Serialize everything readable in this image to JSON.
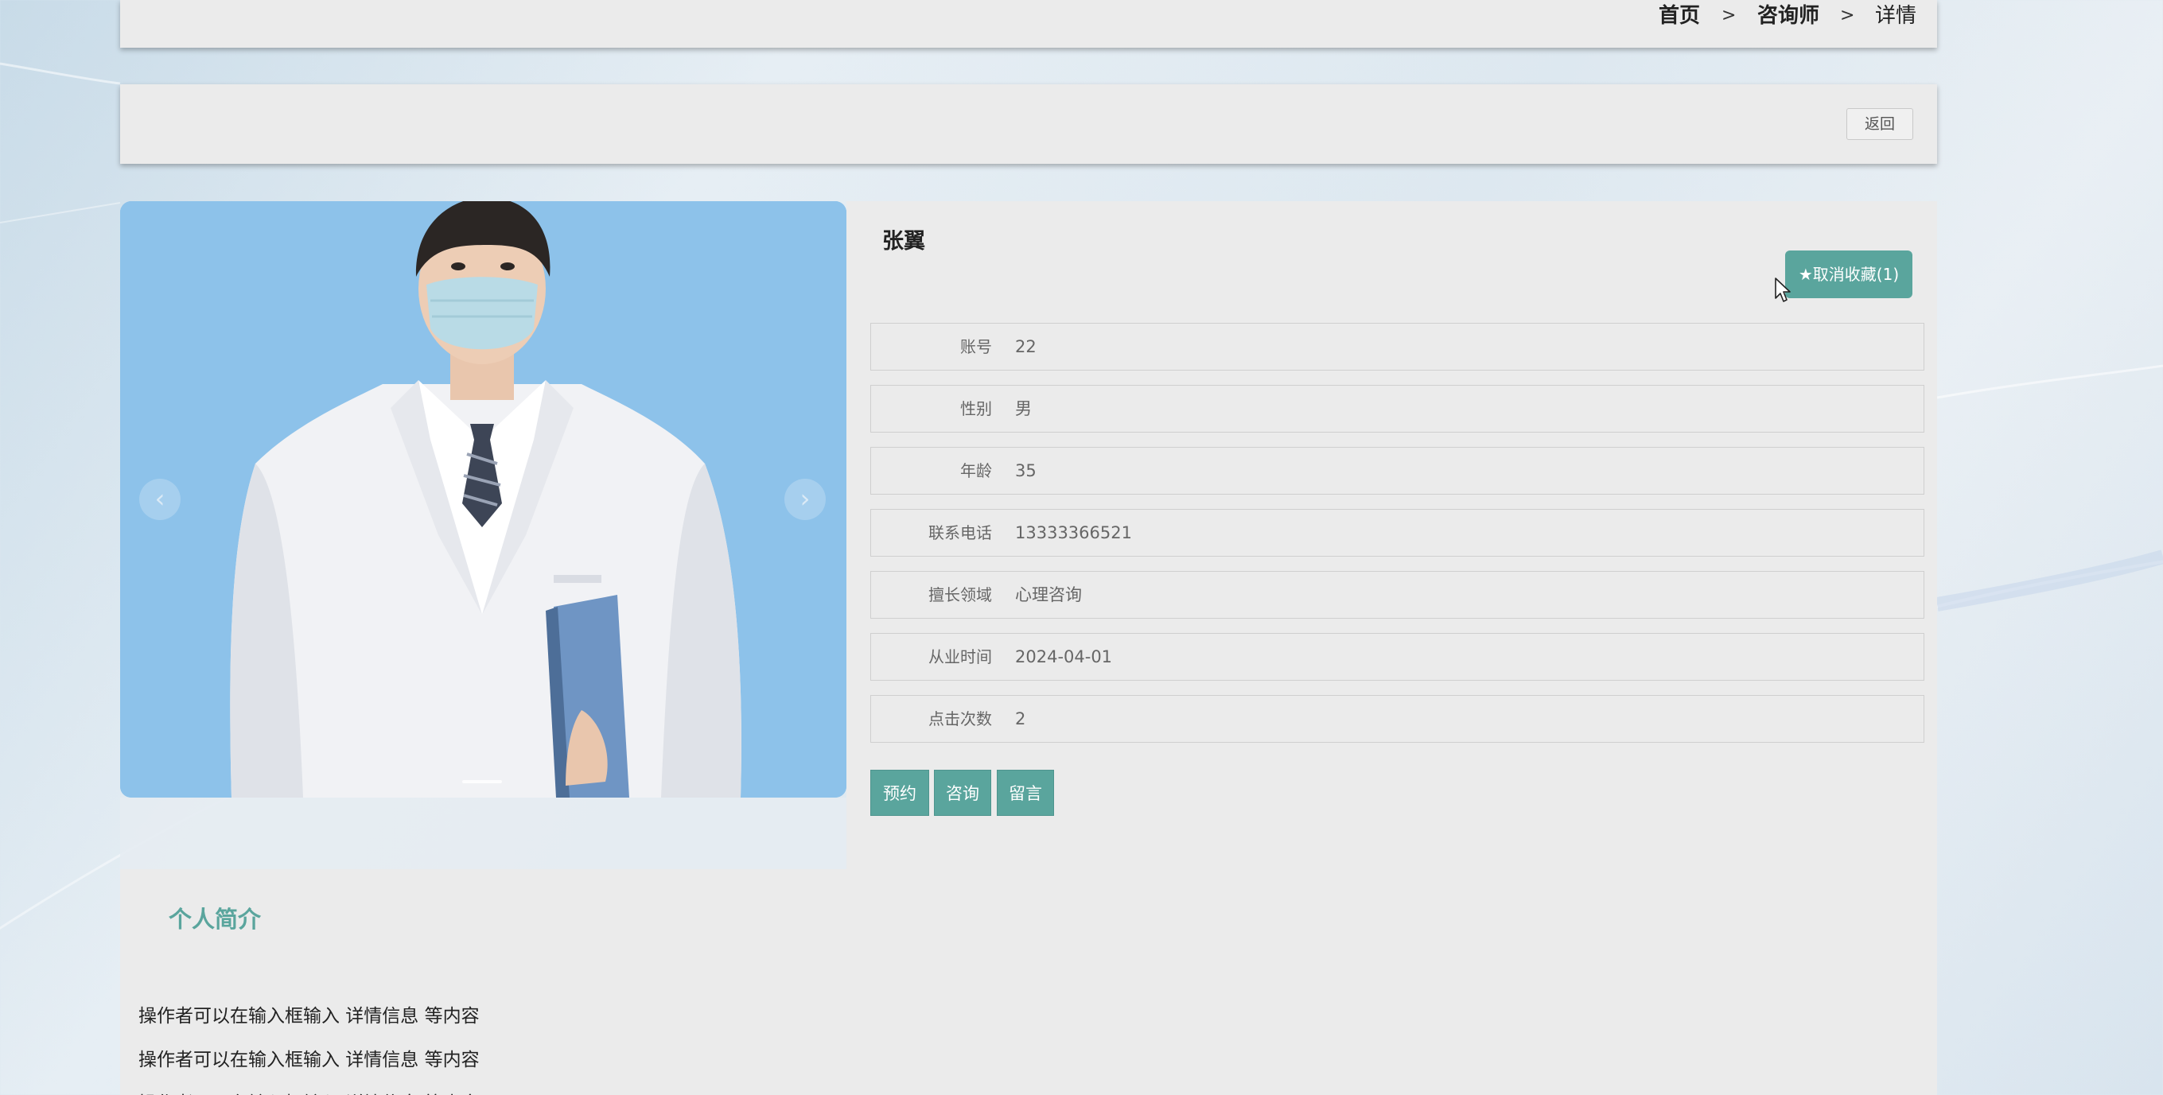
{
  "breadcrumb": {
    "home": "首页",
    "separator_1": ">",
    "section": "咨询师",
    "separator_2": ">",
    "current": "详情"
  },
  "toolbar": {
    "back_label": "返回"
  },
  "carousel": {
    "prev_glyph": "‹",
    "next_glyph": "›"
  },
  "counselor": {
    "name": "张翼",
    "favorite_label": "★取消收藏(1)",
    "fields": [
      {
        "label": "账号",
        "value": "22"
      },
      {
        "label": "性别",
        "value": "男"
      },
      {
        "label": "年龄",
        "value": "35"
      },
      {
        "label": "联系电话",
        "value": "13333366521"
      },
      {
        "label": "擅长领域",
        "value": "心理咨询"
      },
      {
        "label": "从业时间",
        "value": "2024-04-01"
      },
      {
        "label": "点击次数",
        "value": "2"
      }
    ],
    "actions": {
      "book": "预约",
      "consult": "咨询",
      "message": "留言"
    }
  },
  "intro": {
    "title": "个人简介",
    "lines": [
      "操作者可以在输入框输入  详情信息  等内容",
      "操作者可以在输入框输入  详情信息  等内容",
      "操作者可以在输入框输入  详情信息  等内容"
    ]
  },
  "colors": {
    "accent": "#5aa59d",
    "panel": "#ebebeb",
    "photo_background": "#8dc2ea"
  },
  "icons": {
    "star": "star-icon",
    "prev": "chevron-left-icon",
    "next": "chevron-right-icon",
    "cursor": "mouse-pointer-icon"
  }
}
